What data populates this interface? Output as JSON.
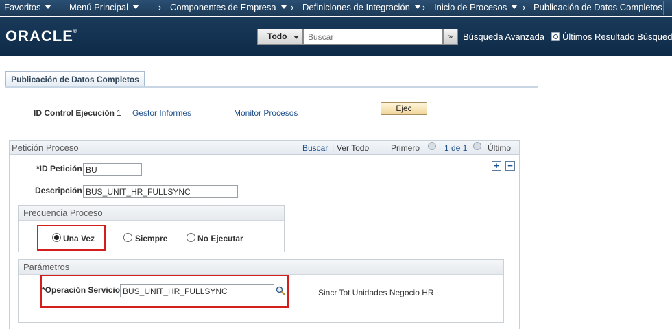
{
  "navbar": {
    "items": [
      {
        "label": "Favoritos",
        "has_caret": true
      },
      {
        "label": "Menú Principal",
        "has_caret": true
      },
      {
        "label": "Componentes de Empresa",
        "has_caret": true
      },
      {
        "label": "Definiciones de Integración",
        "has_caret": true
      },
      {
        "label": "Inicio de Procesos",
        "has_caret": true
      },
      {
        "label": "Publicación de Datos Completos",
        "has_caret": false
      }
    ],
    "breadcrumb_separator": "›"
  },
  "header": {
    "logo": "ORACLE",
    "search_scope": "Todo",
    "search_placeholder": "Buscar",
    "search_go": "»",
    "advanced_search": "Búsqueda Avanzada",
    "recent_results": "Últimos Resultado Búsqueda"
  },
  "page": {
    "tab_label": "Publicación de Datos Completos",
    "run_control_label": "ID Control Ejecución",
    "run_control_value": "1",
    "report_manager": "Gestor Informes",
    "process_monitor": "Monitor Procesos",
    "run_button": "Ejec"
  },
  "grid": {
    "title": "Petición Proceso",
    "find_link": "Buscar",
    "view_all_sep": "|",
    "view_all": "Ver Todo",
    "first": "Primero",
    "counter": "1 de 1",
    "last": "Último",
    "add": "+",
    "remove": "−",
    "request_id_label": "*ID Petición",
    "request_id_value": "BU",
    "description_label": "Descripción",
    "description_value": "BUS_UNIT_HR_FULLSYNC"
  },
  "frequency": {
    "title": "Frecuencia Proceso",
    "options": [
      {
        "label": "Una Vez",
        "checked": true
      },
      {
        "label": "Siempre",
        "checked": false
      },
      {
        "label": "No Ejecutar",
        "checked": false
      }
    ]
  },
  "parameters": {
    "title": "Parámetros",
    "service_op_label": "*Operación Servicio",
    "service_op_value": "BUS_UNIT_HR_FULLSYNC",
    "service_op_description": "Sincr Tot Unidades Negocio HR"
  },
  "colors": {
    "nav_bg": "#244a6e",
    "header_bg": "#143454",
    "highlight": "#d41d1d",
    "link": "#1f4f8c"
  }
}
